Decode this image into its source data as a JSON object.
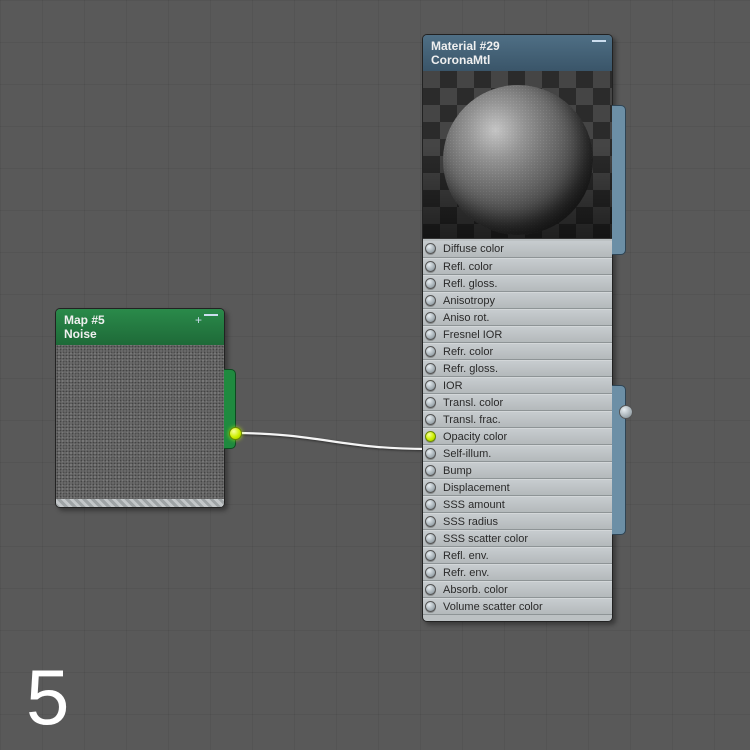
{
  "page_number": "5",
  "nodes": {
    "map": {
      "title": "Map #5",
      "type": "Noise",
      "output_connected": true
    },
    "material": {
      "title": "Material #29",
      "type": "CoronaMtl",
      "slots": [
        {
          "label": "Diffuse color",
          "connected": false
        },
        {
          "label": "Refl. color",
          "connected": false
        },
        {
          "label": "Refl. gloss.",
          "connected": false
        },
        {
          "label": "Anisotropy",
          "connected": false
        },
        {
          "label": "Aniso rot.",
          "connected": false
        },
        {
          "label": "Fresnel IOR",
          "connected": false
        },
        {
          "label": "Refr. color",
          "connected": false
        },
        {
          "label": "Refr. gloss.",
          "connected": false
        },
        {
          "label": "IOR",
          "connected": false
        },
        {
          "label": "Transl. color",
          "connected": false
        },
        {
          "label": "Transl. frac.",
          "connected": false
        },
        {
          "label": "Opacity color",
          "connected": true
        },
        {
          "label": "Self-illum.",
          "connected": false
        },
        {
          "label": "Bump",
          "connected": false
        },
        {
          "label": "Displacement",
          "connected": false
        },
        {
          "label": "SSS amount",
          "connected": false
        },
        {
          "label": "SSS radius",
          "connected": false
        },
        {
          "label": "SSS scatter color",
          "connected": false
        },
        {
          "label": "Refl. env.",
          "connected": false
        },
        {
          "label": "Refr. env.",
          "connected": false
        },
        {
          "label": "Absorb. color",
          "connected": false
        },
        {
          "label": "Volume scatter color",
          "connected": false
        }
      ]
    }
  },
  "connection": {
    "from": "map.output",
    "to": "material.Opacity color"
  },
  "colors": {
    "map_header": "#1f8a3f",
    "material_header": "#4f6f85",
    "wire": "#ffffff",
    "socket_connected": "#cdef00"
  }
}
